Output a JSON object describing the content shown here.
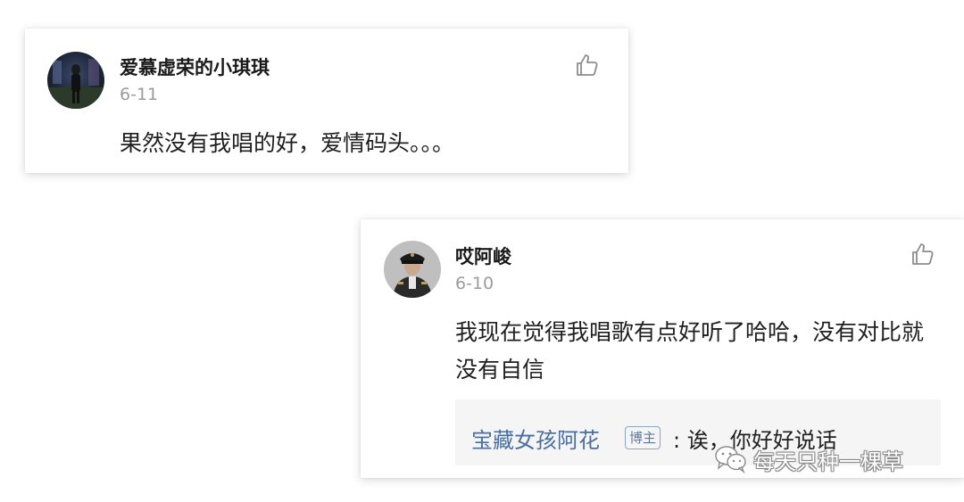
{
  "comments": [
    {
      "username": "爱慕虚荣的小琪琪",
      "date": "6-11",
      "text": "果然没有我唱的好，爱情码头。。。"
    },
    {
      "username": "哎阿峻",
      "date": "6-10",
      "text": "我现在觉得我唱歌有点好听了哈哈，没有对比就没有自信",
      "reply": {
        "author": "宝藏女孩阿花",
        "badge": "博主",
        "text": ": 诶，你好好说话"
      }
    }
  ],
  "watermark": {
    "text": "每天只种一棵草"
  },
  "colors": {
    "reply_author": "#4a6ea0",
    "date": "#9b9b9b",
    "reply_bg": "#f5f5f5"
  }
}
